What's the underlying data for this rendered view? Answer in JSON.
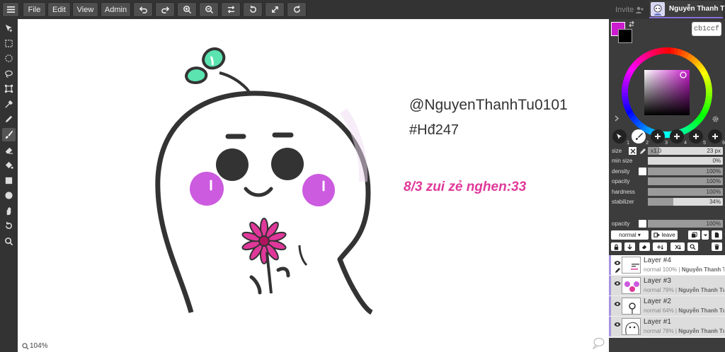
{
  "menu": {
    "file": "File",
    "edit": "Edit",
    "view": "View",
    "admin": "Admin"
  },
  "header": {
    "invite": "Invite",
    "user_name": "Nguyễn Thanh Tú"
  },
  "canvas": {
    "handle": "@NguyenThanhTu0101",
    "tag": "#Hđ247",
    "note": "8/3 zui zẻ nghen:33",
    "zoom": "104%"
  },
  "colors": {
    "primary": "#cb1ccf",
    "secondary": "#000000",
    "hex_value": "cb1ccf",
    "accent": "#8a6dd8"
  },
  "brushes": {
    "slots": [
      "1",
      "2",
      "3",
      "4",
      "5",
      "6"
    ]
  },
  "settings": {
    "size_label": "size",
    "size_multiplier": "x1.0",
    "size_value": "23 px",
    "size_fill": 0.15,
    "min_size_label": "min size",
    "min_size_value": "0%",
    "min_size_fill": 0,
    "density_label": "density",
    "density_value": "100%",
    "density_fill": 1,
    "opacity_label": "opacity",
    "opacity_value": "100%",
    "opacity_fill": 1,
    "hardness_label": "hardness",
    "hardness_value": "100%",
    "hardness_fill": 1,
    "stabilizer_label": "stabilizer",
    "stabilizer_value": "34%",
    "stabilizer_fill": 0.34,
    "layer_opacity_label": "opacity",
    "layer_opacity_value": "100%",
    "layer_opacity_fill": 1
  },
  "layer_controls": {
    "blend": "normal",
    "leave": "leave"
  },
  "layers": [
    {
      "name": "Layer #4",
      "blend": "normal",
      "opacity": "100%",
      "owner": "Nguyễn Thanh Tú"
    },
    {
      "name": "Layer #3",
      "blend": "normal",
      "opacity": "79%",
      "owner": "Nguyễn Thanh Tú"
    },
    {
      "name": "Layer #2",
      "blend": "normal",
      "opacity": "64%",
      "owner": "Nguyễn Thanh Tú"
    },
    {
      "name": "Layer #1",
      "blend": "normal",
      "opacity": "78%",
      "owner": "Nguyễn Thanh Tú"
    }
  ]
}
